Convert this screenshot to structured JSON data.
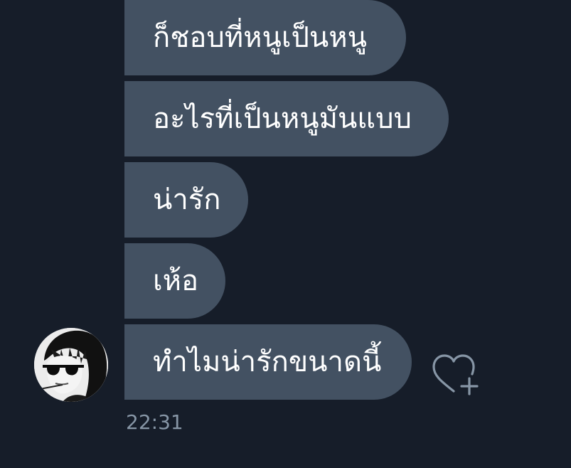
{
  "conversation": {
    "messages": [
      {
        "text": "ก็ชอบที่หนูเป็นหนู"
      },
      {
        "text": "อะไรที่เป็นหนูมันแบบ"
      },
      {
        "text": "น่ารัก"
      },
      {
        "text": "เห้อ"
      },
      {
        "text": "ทำไมน่ารักขนาดนี้"
      }
    ],
    "timestamp": "22:31",
    "sender_avatar_icon": "user-avatar",
    "react_icon": "heart-plus-icon"
  },
  "colors": {
    "background": "#161d29",
    "bubble": "#435162",
    "message_text": "#ffffff",
    "timestamp_text": "#8796a6",
    "react_icon": "#8796a6"
  }
}
